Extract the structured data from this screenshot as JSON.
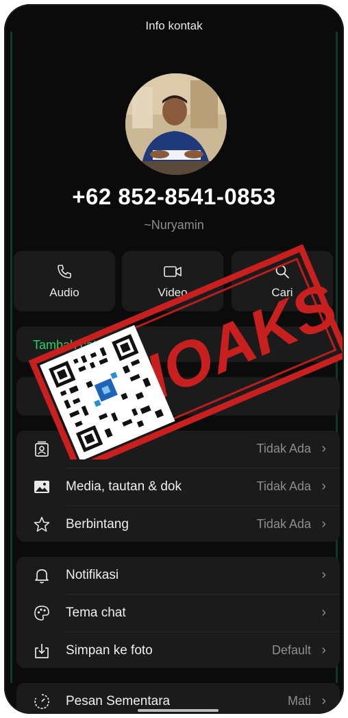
{
  "header": {
    "title": "Info kontak"
  },
  "contact": {
    "phone": "+62 852-8541-0853",
    "name": "~Nuryamin"
  },
  "actions": [
    {
      "label": "Audio",
      "icon": "phone-icon"
    },
    {
      "label": "Video",
      "icon": "video-icon"
    },
    {
      "label": "Cari",
      "icon": "search-icon"
    }
  ],
  "note": {
    "label": "Tambah catatan"
  },
  "media_section": [
    {
      "icon": "contact-card-icon",
      "label": "",
      "value": "Tidak Ada"
    },
    {
      "icon": "image-icon",
      "label": "Media, tautan & dok",
      "value": "Tidak Ada"
    },
    {
      "icon": "star-icon",
      "label": "Berbintang",
      "value": "Tidak Ada"
    }
  ],
  "settings_section": [
    {
      "icon": "bell-icon",
      "label": "Notifikasi",
      "value": ""
    },
    {
      "icon": "palette-icon",
      "label": "Tema chat",
      "value": ""
    },
    {
      "icon": "download-icon",
      "label": "Simpan ke foto",
      "value": "Default"
    }
  ],
  "disappearing": {
    "icon": "timer-icon",
    "label": "Pesan Sementara",
    "value": "Mati"
  },
  "overlay": {
    "stamp_text": "HOAKS",
    "stamp_color": "#c8201f"
  },
  "colors": {
    "background": "#0b0b0b",
    "card": "#1b1b1b",
    "accent_green": "#25d366"
  }
}
